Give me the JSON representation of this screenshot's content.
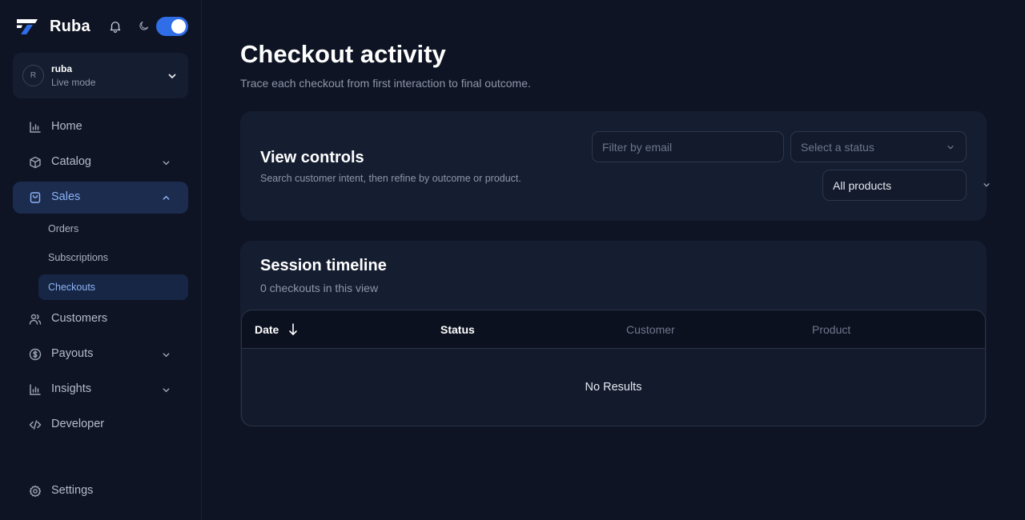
{
  "brand": {
    "name": "Ruba"
  },
  "theme_toggle": {
    "state": "on"
  },
  "account": {
    "initial": "R",
    "name": "ruba",
    "mode": "Live mode"
  },
  "nav": {
    "home": "Home",
    "catalog": "Catalog",
    "sales": "Sales",
    "sales_sub": {
      "orders": "Orders",
      "subscriptions": "Subscriptions",
      "checkouts": "Checkouts"
    },
    "customers": "Customers",
    "payouts": "Payouts",
    "insights": "Insights",
    "developer": "Developer",
    "settings": "Settings"
  },
  "page": {
    "title": "Checkout activity",
    "subtitle": "Trace each checkout from first interaction to final outcome."
  },
  "controls": {
    "title": "View controls",
    "subtitle": "Search customer intent, then refine by outcome or product.",
    "email_placeholder": "Filter by email",
    "status_placeholder": "Select a status",
    "product_value": "All products"
  },
  "timeline": {
    "title": "Session timeline",
    "count_text": "0 checkouts in this view",
    "columns": [
      "Date",
      "Status",
      "Customer",
      "Product"
    ],
    "empty_text": "No Results"
  },
  "colors": {
    "background": "#0e1424",
    "card": "#151d30",
    "accent": "#2f6ee6",
    "active_text": "#8db4f5"
  }
}
